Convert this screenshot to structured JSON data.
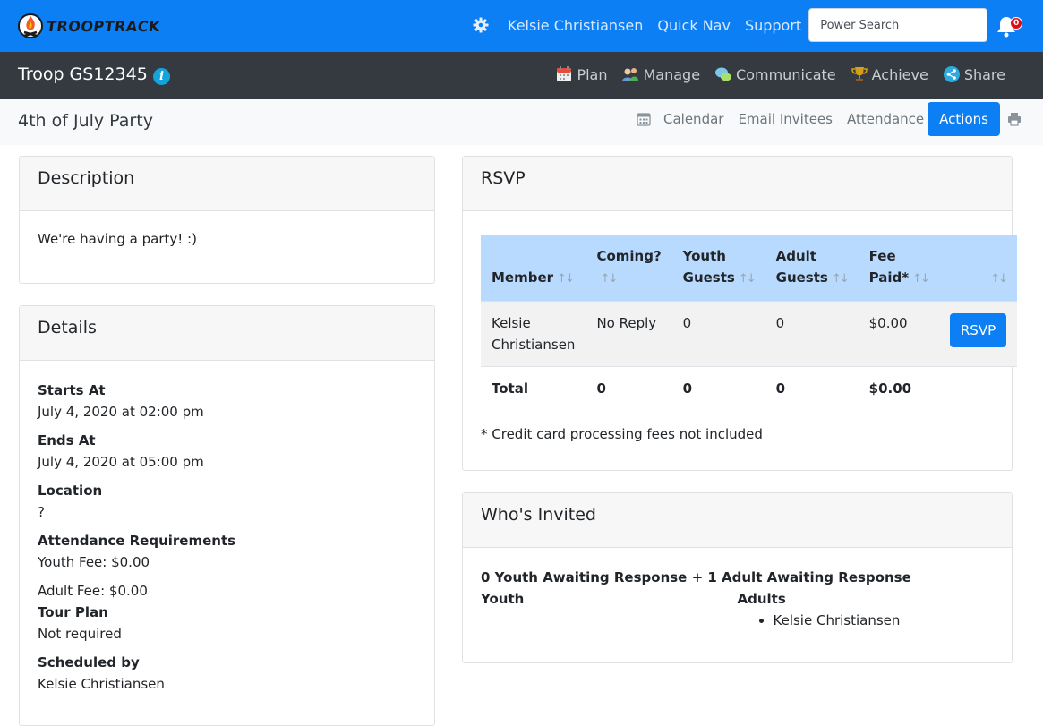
{
  "app": {
    "logo_text": "TROOPTRACK",
    "user_name": "Kelsie Christiansen",
    "quick_nav": "Quick Nav",
    "support": "Support",
    "search_placeholder": "Power Search",
    "notification_count": "0"
  },
  "troop": {
    "title": "Troop GS12345",
    "nav": [
      {
        "label": "Plan",
        "icon": "calendar-icon"
      },
      {
        "label": "Manage",
        "icon": "people-icon"
      },
      {
        "label": "Communicate",
        "icon": "chat-bubbles-icon"
      },
      {
        "label": "Achieve",
        "icon": "trophy-icon"
      },
      {
        "label": "Share",
        "icon": "share-icon"
      }
    ]
  },
  "event": {
    "title": "4th of July Party",
    "nav": {
      "calendar": "Calendar",
      "email_invitees": "Email Invitees",
      "attendance": "Attendance",
      "actions": "Actions"
    }
  },
  "description": {
    "header": "Description",
    "text": "We're having a party! :)"
  },
  "details": {
    "header": "Details",
    "starts_label": "Starts At",
    "starts_value": "July 4, 2020 at 02:00 pm",
    "ends_label": "Ends At",
    "ends_value": "July 4, 2020 at 05:00 pm",
    "location_label": "Location",
    "location_value": "?",
    "attendance_label": "Attendance Requirements",
    "youth_fee": "Youth Fee: $0.00",
    "adult_fee": "Adult Fee: $0.00",
    "tour_label": "Tour Plan",
    "tour_value": "Not required",
    "scheduled_label": "Scheduled by",
    "scheduled_value": "Kelsie Christiansen"
  },
  "rsvp": {
    "header": "RSVP",
    "columns": {
      "member": "Member",
      "coming": "Coming?",
      "youth_guests_1": "Youth",
      "youth_guests_2": "Guests",
      "adult_guests_1": "Adult",
      "adult_guests_2": "Guests",
      "fee_1": "Fee",
      "fee_2": "Paid*"
    },
    "row": {
      "member_1": "Kelsie",
      "member_2": "Christiansen",
      "coming": "No Reply",
      "youth_guests": "0",
      "adult_guests": "0",
      "fee": "$0.00",
      "button": "RSVP"
    },
    "total": {
      "label": "Total",
      "coming": "0",
      "youth_guests": "0",
      "adult_guests": "0",
      "fee": "$0.00"
    },
    "footnote": "* Credit card processing fees not included"
  },
  "invited": {
    "header": "Who's Invited",
    "summary": "0 Youth Awaiting Response + 1 Adult Awaiting Response",
    "youth_label": "Youth",
    "adults_label": "Adults",
    "adults": [
      "Kelsie Christiansen"
    ]
  },
  "colors": {
    "brand_blue": "#0d7ff5",
    "dark_bar": "#343a40",
    "table_header": "#b8daff"
  }
}
